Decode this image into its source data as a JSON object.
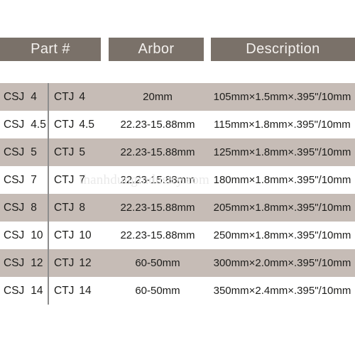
{
  "table": {
    "headers": [
      {
        "id": "part",
        "label": "Part #"
      },
      {
        "id": "arbor",
        "label": "Arbor"
      },
      {
        "id": "description",
        "label": "Description"
      }
    ],
    "rows": [
      {
        "part_prefix": "CSJ",
        "part_number": "4",
        "arbor_prefix": "CTJ",
        "arbor_number": "4",
        "arbor_size": "20mm",
        "description": "105mm×1.5mm×.395\"/10mm",
        "striped": true
      },
      {
        "part_prefix": "CSJ",
        "part_number": "4.5",
        "arbor_prefix": "CTJ",
        "arbor_number": "4.5",
        "arbor_size": "22.23-15.88mm",
        "description": "115mm×1.8mm×.395\"/10mm",
        "striped": false
      },
      {
        "part_prefix": "CSJ",
        "part_number": "5",
        "arbor_prefix": "CTJ",
        "arbor_number": "5",
        "arbor_size": "22.23-15.88mm",
        "description": "125mm×1.8mm×.395\"/10mm",
        "striped": true
      },
      {
        "part_prefix": "CSJ",
        "part_number": "7",
        "arbor_prefix": "CTJ",
        "arbor_number": "7",
        "arbor_size": "22.23-15.88mm",
        "description": "180mm×1.8mm×.395\"/10mm",
        "striped": false
      },
      {
        "part_prefix": "CSJ",
        "part_number": "8",
        "arbor_prefix": "CTJ",
        "arbor_number": "8",
        "arbor_size": "22.23-15.88mm",
        "description": "205mm×1.8mm×.395\"/10mm",
        "striped": true
      },
      {
        "part_prefix": "CSJ",
        "part_number": "10",
        "arbor_prefix": "CTJ",
        "arbor_number": "10",
        "arbor_size": "22.23-15.88mm",
        "description": "250mm×1.8mm×.395\"/10mm",
        "striped": false
      },
      {
        "part_prefix": "CSJ",
        "part_number": "12",
        "arbor_prefix": "CTJ",
        "arbor_number": "12",
        "arbor_size": "60-50mm",
        "description": "300mm×2.0mm×.395\"/10mm",
        "striped": true
      },
      {
        "part_prefix": "CSJ",
        "part_number": "14",
        "arbor_prefix": "CTJ",
        "arbor_number": "14",
        "arbor_size": "60-50mm",
        "description": "350mm×2.4mm×.395\"/10mm",
        "striped": false
      }
    ]
  },
  "watermark": {
    "text": "thanhdungindustry.com"
  },
  "colors": {
    "header_background": "#7a7169",
    "header_text": "#f4f1ee",
    "striped_row": "#c6bcb6",
    "plain_row": "#ffffff",
    "body_text": "#1d1d1b",
    "divider": "#8d8d8d",
    "watermark_text": "#e9e9e9"
  }
}
